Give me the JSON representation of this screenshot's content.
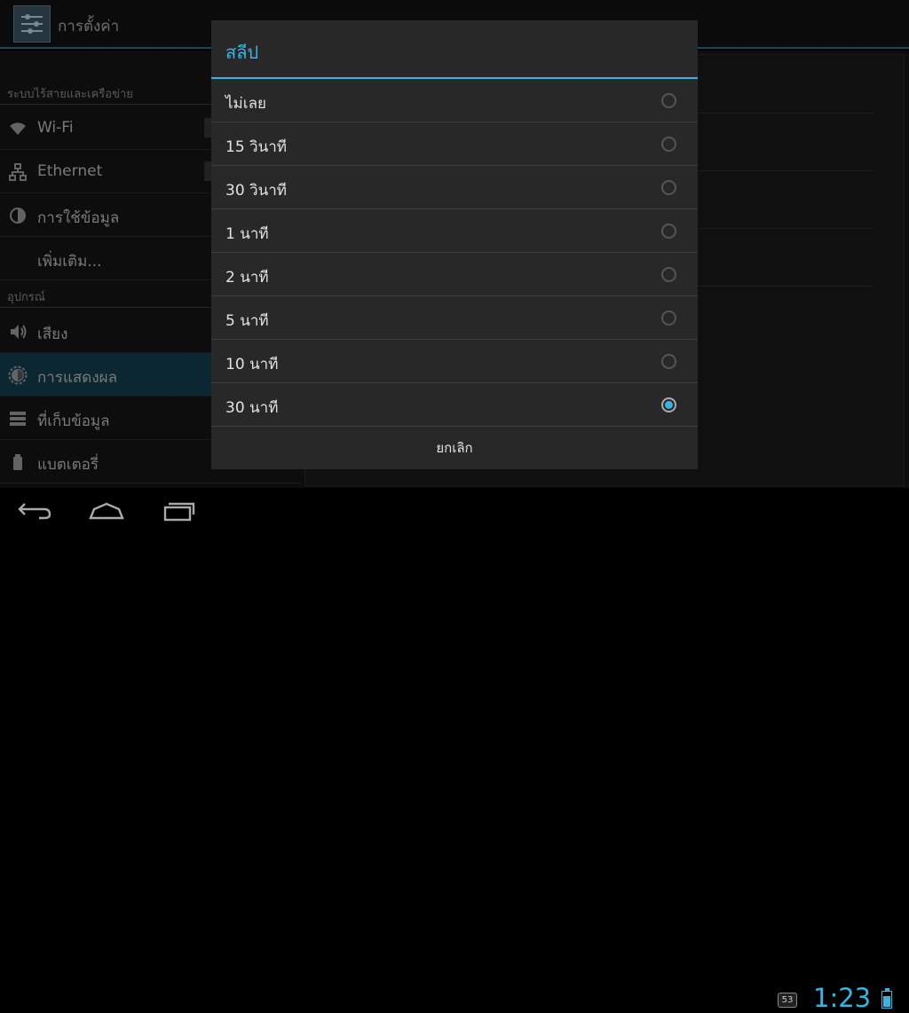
{
  "actionbar": {
    "title": "การตั้งค่า",
    "icon": "settings-icon"
  },
  "sections": [
    {
      "header": "ระบบไร้สายและเครือข่าย"
    },
    {
      "header": "อุปกรณ์"
    }
  ],
  "items": [
    {
      "label": "Wi-Fi",
      "icon": "wifi-icon"
    },
    {
      "label": "Ethernet",
      "icon": "ethernet-icon"
    },
    {
      "label": "การใช้ข้อมูล",
      "icon": "data-usage-icon"
    },
    {
      "label": "เพิ่มเติม..."
    },
    {
      "label": "เสียง",
      "icon": "sound-icon"
    },
    {
      "label": "การแสดงผล",
      "icon": "display-icon",
      "selected": true
    },
    {
      "label": "ที่เก็บข้อมูล",
      "icon": "storage-icon"
    },
    {
      "label": "แบตเตอรี่",
      "icon": "battery-icon"
    }
  ],
  "dialog": {
    "title": "สลีป",
    "options": [
      {
        "label": "ไม่เลย",
        "checked": false
      },
      {
        "label": "15 วินาที",
        "checked": false
      },
      {
        "label": "30 วินาที",
        "checked": false
      },
      {
        "label": "1 นาที",
        "checked": false
      },
      {
        "label": "2 นาที",
        "checked": false
      },
      {
        "label": "5 นาที",
        "checked": false
      },
      {
        "label": "10 นาที",
        "checked": false
      },
      {
        "label": "30 นาที",
        "checked": true
      }
    ],
    "cancel": "ยกเลิก"
  },
  "statusbar": {
    "time": "1:23",
    "notification_badge": "53"
  },
  "colors": {
    "accent": "#33b5e5",
    "selected_bg": "#123c4d"
  }
}
